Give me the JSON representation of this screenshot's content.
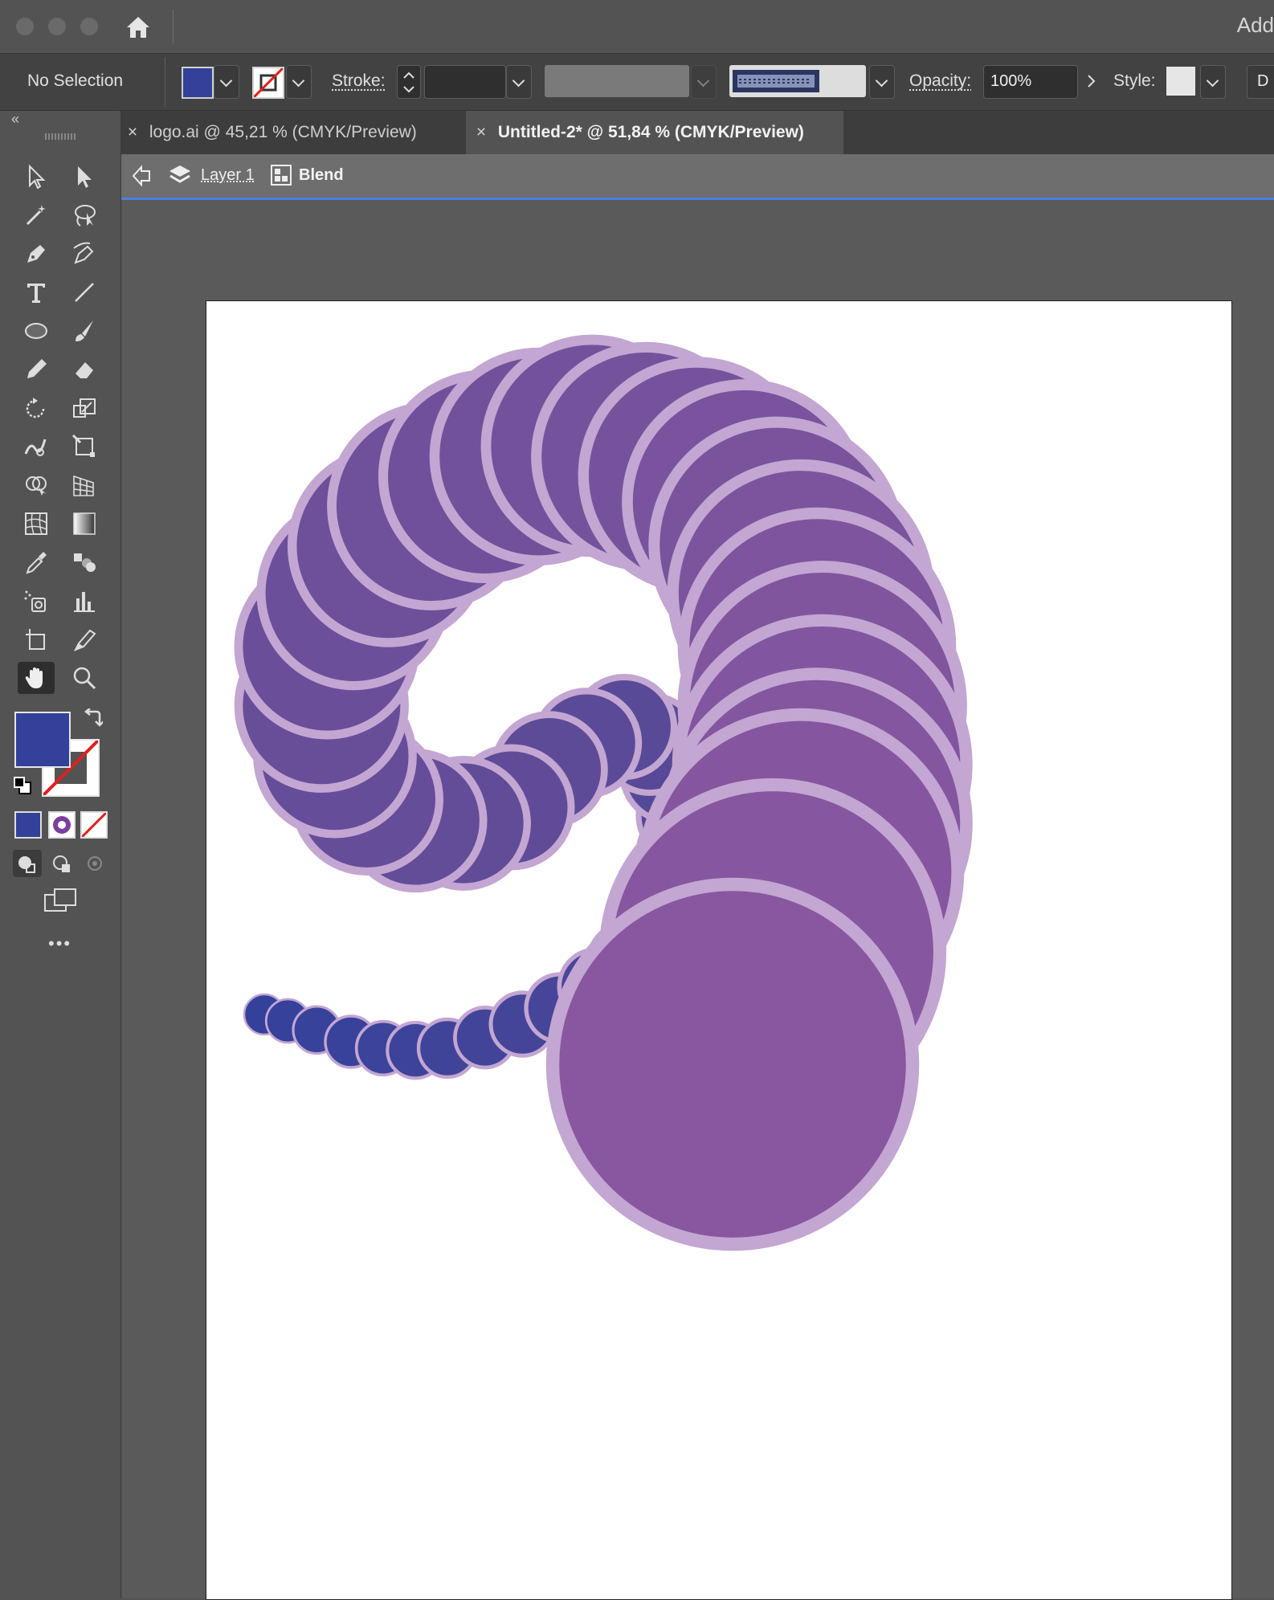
{
  "app": {
    "name_partial": "Add"
  },
  "control_bar": {
    "selection_status": "No Selection",
    "fill_color": "#33419a",
    "stroke_label": "Stroke:",
    "opacity_label": "Opacity:",
    "opacity_value": "100%",
    "style_label": "Style:",
    "doc_setup_partial": "D"
  },
  "tabs": [
    {
      "label": "logo.ai @ 45,21 % (CMYK/Preview)",
      "active": false
    },
    {
      "label": "Untitled-2* @ 51,84 % (CMYK/Preview)",
      "active": true
    }
  ],
  "breadcrumb": {
    "layer": "Layer 1",
    "group": "Blend"
  },
  "toolbar": {
    "tools": [
      "selection-icon",
      "direct-selection-icon",
      "magic-wand-icon",
      "lasso-icon",
      "pen-icon",
      "curvature-icon",
      "type-icon",
      "line-segment-icon",
      "ellipse-icon",
      "paintbrush-icon",
      "pencil-icon",
      "eraser-icon",
      "rotate-icon",
      "scale-icon",
      "warp-icon",
      "free-transform-icon",
      "shape-builder-icon",
      "perspective-grid-icon",
      "mesh-icon",
      "gradient-icon",
      "eyedropper-icon",
      "blend-icon",
      "symbol-sprayer-icon",
      "column-graph-icon",
      "artboard-icon",
      "slice-icon",
      "hand-icon",
      "zoom-icon"
    ],
    "active_tool": "hand-icon",
    "fill_swatch": "#33419a",
    "more_label": "•••"
  },
  "artwork": {
    "stroke_color": "#c3a6d2",
    "color_small": "#33419a",
    "color_mid": "#624c98",
    "color_large": "#8857a0"
  }
}
